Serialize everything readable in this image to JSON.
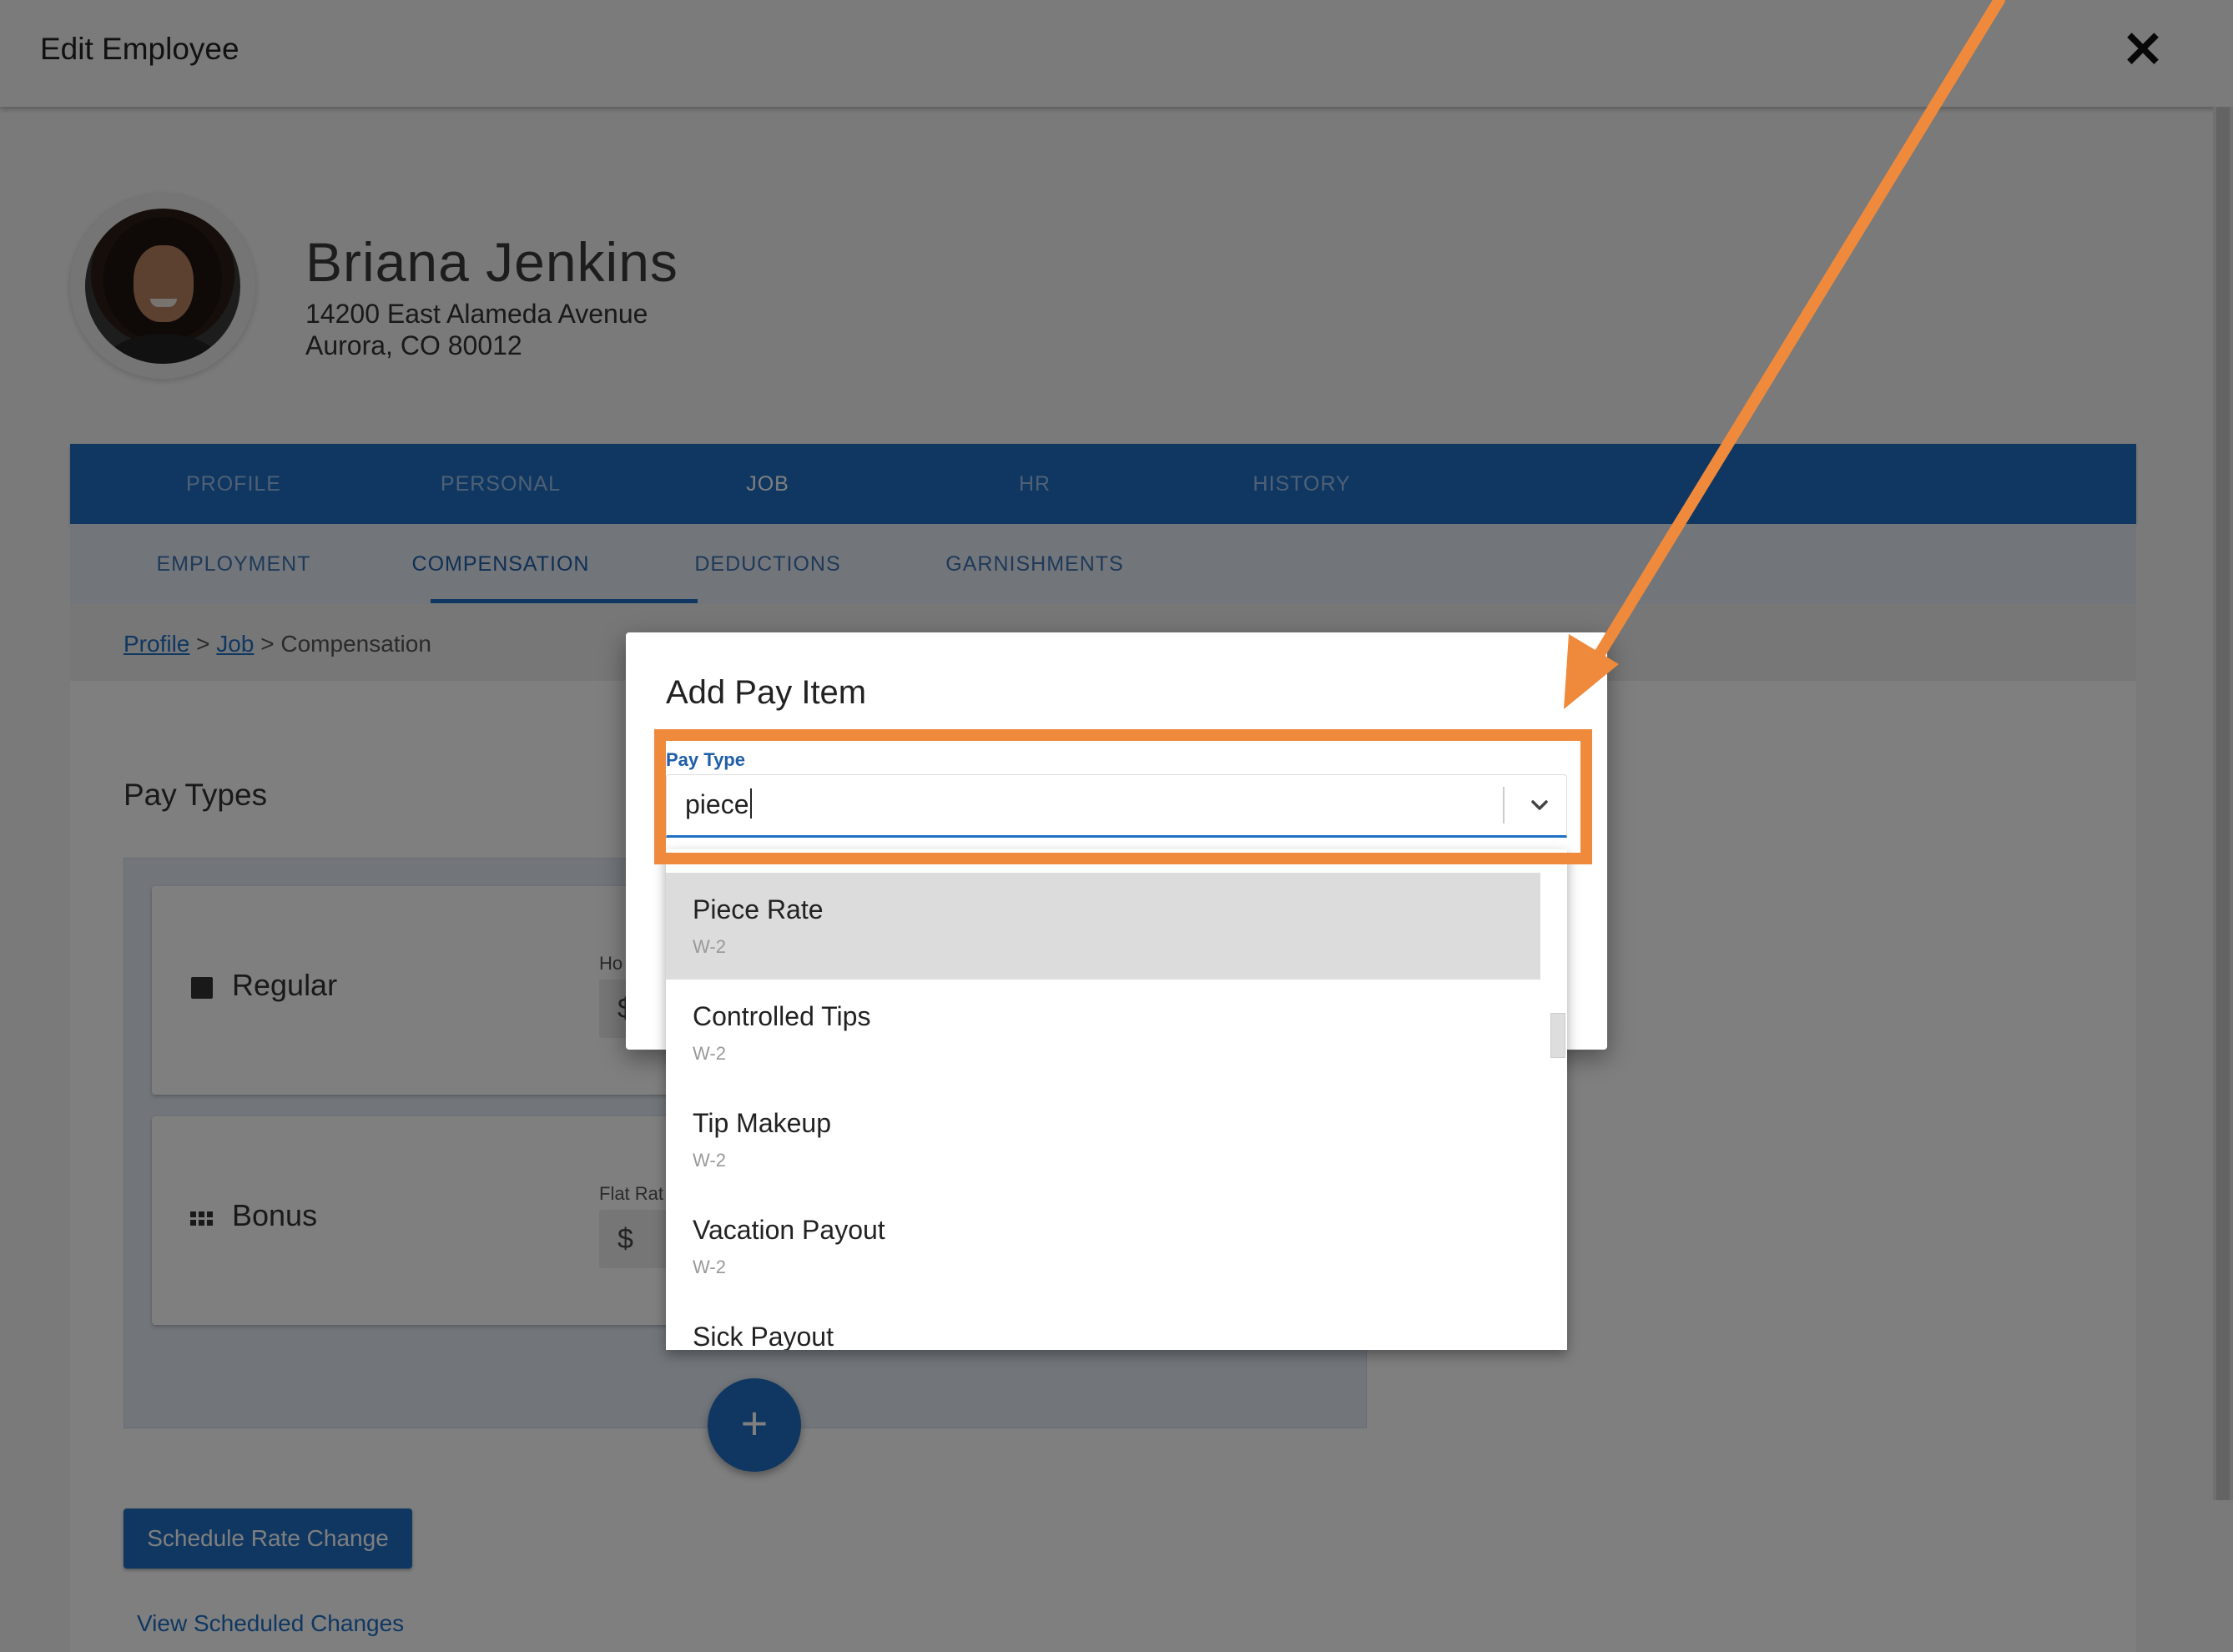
{
  "window": {
    "title": "Edit Employee"
  },
  "employee": {
    "name": "Briana Jenkins",
    "address_line1": "14200 East Alameda Avenue",
    "address_line2": "Aurora, CO 80012"
  },
  "main_tabs": [
    {
      "label": "PROFILE"
    },
    {
      "label": "PERSONAL"
    },
    {
      "label": "JOB"
    },
    {
      "label": "HR"
    },
    {
      "label": "HISTORY"
    }
  ],
  "active_main_tab": "JOB",
  "sub_tabs": [
    {
      "label": "EMPLOYMENT"
    },
    {
      "label": "COMPENSATION"
    },
    {
      "label": "DEDUCTIONS"
    },
    {
      "label": "GARNISHMENTS"
    }
  ],
  "active_sub_tab": "COMPENSATION",
  "breadcrumb": {
    "link1": "Profile",
    "sep1": " > ",
    "link2": "Job",
    "sep2": " > ",
    "current": "Compensation"
  },
  "pay_types": {
    "title": "Pay Types",
    "items": [
      {
        "label": "Regular",
        "field_label": "Ho",
        "field_prefix": "$"
      },
      {
        "label": "Bonus",
        "field_label": "Flat Rat",
        "field_prefix": "$"
      }
    ]
  },
  "fab_label": "+",
  "buttons": {
    "schedule": "Schedule Rate Change",
    "view_scheduled": "View Scheduled Changes"
  },
  "dialog": {
    "title": "Add Pay Item",
    "pay_type_label": "Pay Type",
    "pay_type_value": "piece",
    "options": [
      {
        "name": "Piece Rate",
        "sub": "W-2"
      },
      {
        "name": "Controlled Tips",
        "sub": "W-2"
      },
      {
        "name": "Tip Makeup",
        "sub": "W-2"
      },
      {
        "name": "Vacation Payout",
        "sub": "W-2"
      },
      {
        "name": "Sick Payout",
        "sub": ""
      }
    ]
  },
  "colors": {
    "accent": "#1f6fc5",
    "annotation": "#ef8a3c",
    "overlay": "rgba(0,0,0,0.5)"
  }
}
